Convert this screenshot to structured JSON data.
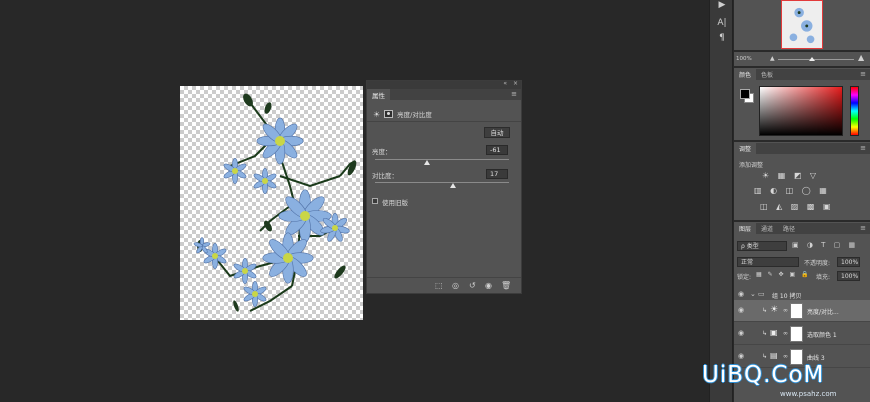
{
  "properties_panel": {
    "collapse_glyph": "«",
    "close_glyph": "×",
    "tab_label": "属性",
    "menu_glyph": "≡",
    "adjustment_title": "亮度/对比度",
    "adjustment_icon": "sun-icon",
    "auto_button": "自动",
    "brightness": {
      "label": "亮度：",
      "value": "-61",
      "slider_fraction": 0.39
    },
    "contrast": {
      "label": "对比度：",
      "value": "17",
      "slider_fraction": 0.58
    },
    "legacy_checkbox": {
      "label": "使用旧版",
      "checked": false
    },
    "footer_icons": [
      "clip-to-layer-icon",
      "view-previous-icon",
      "reset-icon",
      "visibility-icon",
      "trash-icon"
    ]
  },
  "toolbar_right": {
    "glyphs": [
      "▶",
      "A|",
      "¶"
    ]
  },
  "navigator": {
    "zoom": "100%"
  },
  "color_panel": {
    "tabs": [
      "颜色",
      "色板"
    ],
    "menu_glyph": "≡",
    "foreground_color": "#000000",
    "background_color": "#ffffff",
    "picker_hue": "#e51c1c"
  },
  "adjustments_panel": {
    "tab": "调整",
    "hint": "添加调整",
    "menu_glyph": "≡",
    "row1": "☀ ▦ ◩ ▽",
    "row2": "▥ ◐ ◫ ◯ ▦",
    "row3": "◫ ◭ ▨ ▩ ▣"
  },
  "layers_panel": {
    "tabs": [
      "图层",
      "通道",
      "路径"
    ],
    "menu_glyph": "≡",
    "filter_kind": "ρ 类型",
    "blend_mode": "正常",
    "opacity_label": "不透明度:",
    "opacity_value": "100%",
    "lock_label": "锁定:",
    "fill_label": "填充:",
    "fill_value": "100%",
    "filter_icons": "▣ ◑ T ▢ ▦",
    "lock_icons": "▦ ✎ ✥ ▣ 🔒",
    "layers": [
      {
        "name": "组 10 拷贝",
        "type": "group",
        "selected": false
      },
      {
        "name": "亮度/对比...",
        "type": "adjustment",
        "selected": true
      },
      {
        "name": "选取颜色 1",
        "type": "adjustment",
        "selected": false
      },
      {
        "name": "曲线 3",
        "type": "adjustment",
        "selected": false
      }
    ]
  },
  "watermark": {
    "text": "UiBQ.CoM",
    "url": "www.psahz.com"
  },
  "colors": {
    "canvas_bg": "#282828",
    "panel_bg": "#535353",
    "selection": "#6a6a6a",
    "flower_petal": "#8ab0e0",
    "stem": "#1e3a1e"
  }
}
